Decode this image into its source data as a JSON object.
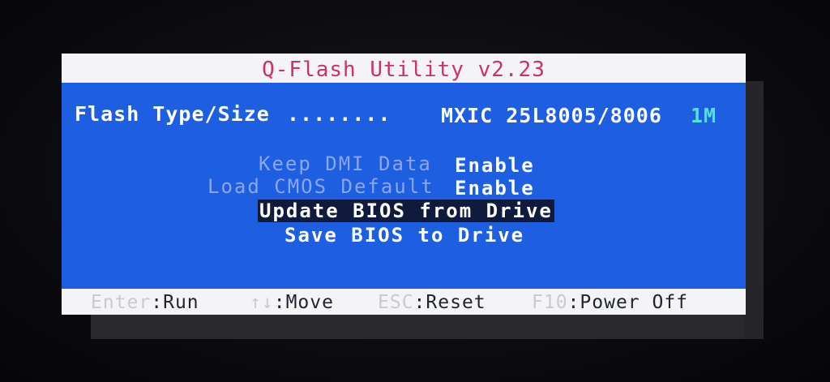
{
  "title": "Q-Flash Utility v2.23",
  "flash": {
    "label": "Flash Type/Size",
    "dots": "........",
    "chip": "MXIC 25L8005/8006",
    "size": "1M"
  },
  "options": [
    {
      "label": "Keep DMI Data",
      "value": "Enable"
    },
    {
      "label": "Load CMOS Default",
      "value": "Enable"
    }
  ],
  "actions": [
    {
      "label": "Update BIOS from Drive",
      "selected": true
    },
    {
      "label": "Save BIOS to Drive",
      "selected": false
    }
  ],
  "footer": [
    {
      "key": "Enter",
      "action": "Run"
    },
    {
      "key": "↑↓",
      "action": "Move"
    },
    {
      "key": "ESC",
      "action": "Reset"
    },
    {
      "key": "F10",
      "action": "Power Off"
    }
  ],
  "colors": {
    "window_bg": "#1d5fe0",
    "title_text": "#d0306a",
    "size_accent": "#4fe3d6",
    "selection_bg": "#101a3c"
  }
}
